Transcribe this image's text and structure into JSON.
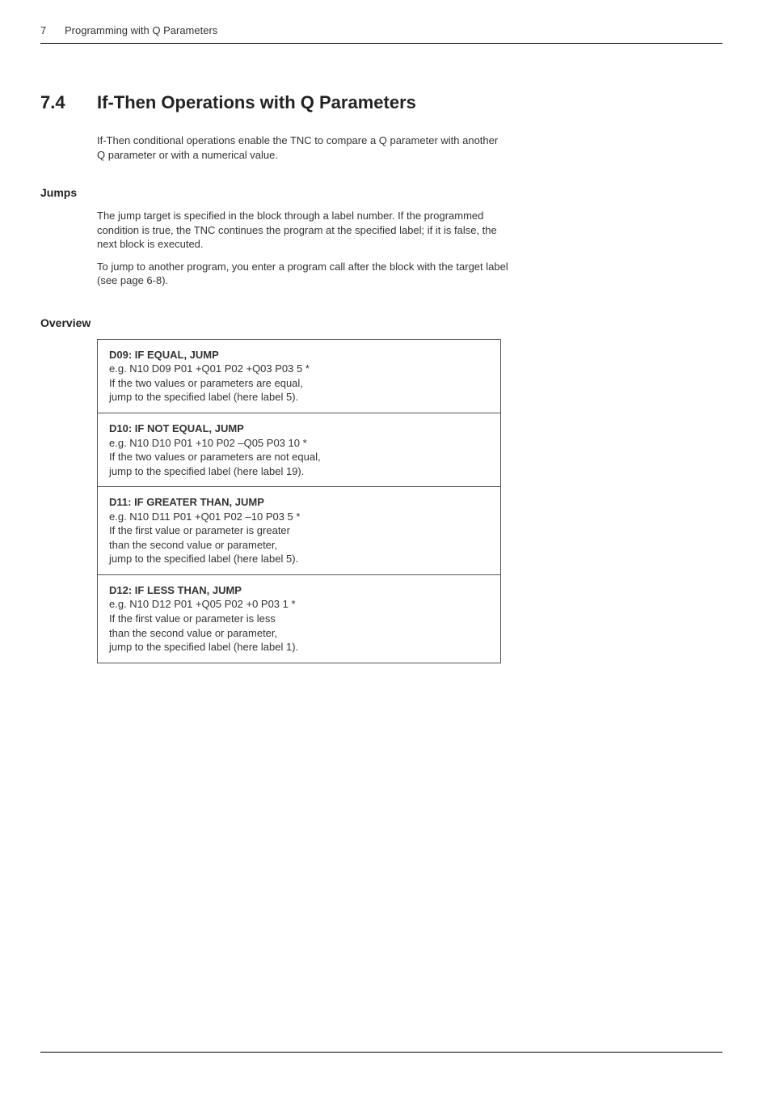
{
  "header": {
    "chapter_number": "7",
    "chapter_title": "Programming with Q Parameters"
  },
  "section": {
    "number": "7.4",
    "title": "If-Then Operations with Q Parameters",
    "intro": "If-Then conditional operations enable the TNC to compare a Q parameter with another Q parameter or with a numerical value."
  },
  "jumps": {
    "heading": "Jumps",
    "para1": "The jump target is specified in the block through a label number. If the programmed condition is true, the TNC continues the program at the specified label; if it is false, the next block is executed.",
    "para2": "To jump to another program, you enter a program call after the block with the target label (see page 6-8)."
  },
  "overview": {
    "heading": "Overview",
    "items": [
      {
        "title": "D09: IF EQUAL, JUMP",
        "example": "e.g. N10 D09 P01 +Q01 P02 +Q03 P03 5 *",
        "line1": "If the two values or parameters are equal,",
        "line2": "jump to the specified label (here label 5)."
      },
      {
        "title": "D10: IF NOT EQUAL, JUMP",
        "example": "e.g. N10 D10 P01 +10 P02 –Q05 P03 10 *",
        "line1": "If the two values or parameters are not equal,",
        "line2": "jump to the specified label (here label 19)."
      },
      {
        "title": "D11: IF GREATER THAN, JUMP",
        "example": "e.g. N10 D11 P01 +Q01 P02 –10 P03 5 *",
        "line1": "If the first value or parameter is greater",
        "line2": "than the second value or parameter,",
        "line3": "jump to the specified label (here label 5)."
      },
      {
        "title": "D12: IF LESS THAN, JUMP",
        "example": "e.g. N10 D12 P01 +Q05 P02 +0 P03 1 *",
        "line1": "If the first value or parameter is less",
        "line2": "than the second value or parameter,",
        "line3": "jump to the specified label (here label 1)."
      }
    ]
  }
}
